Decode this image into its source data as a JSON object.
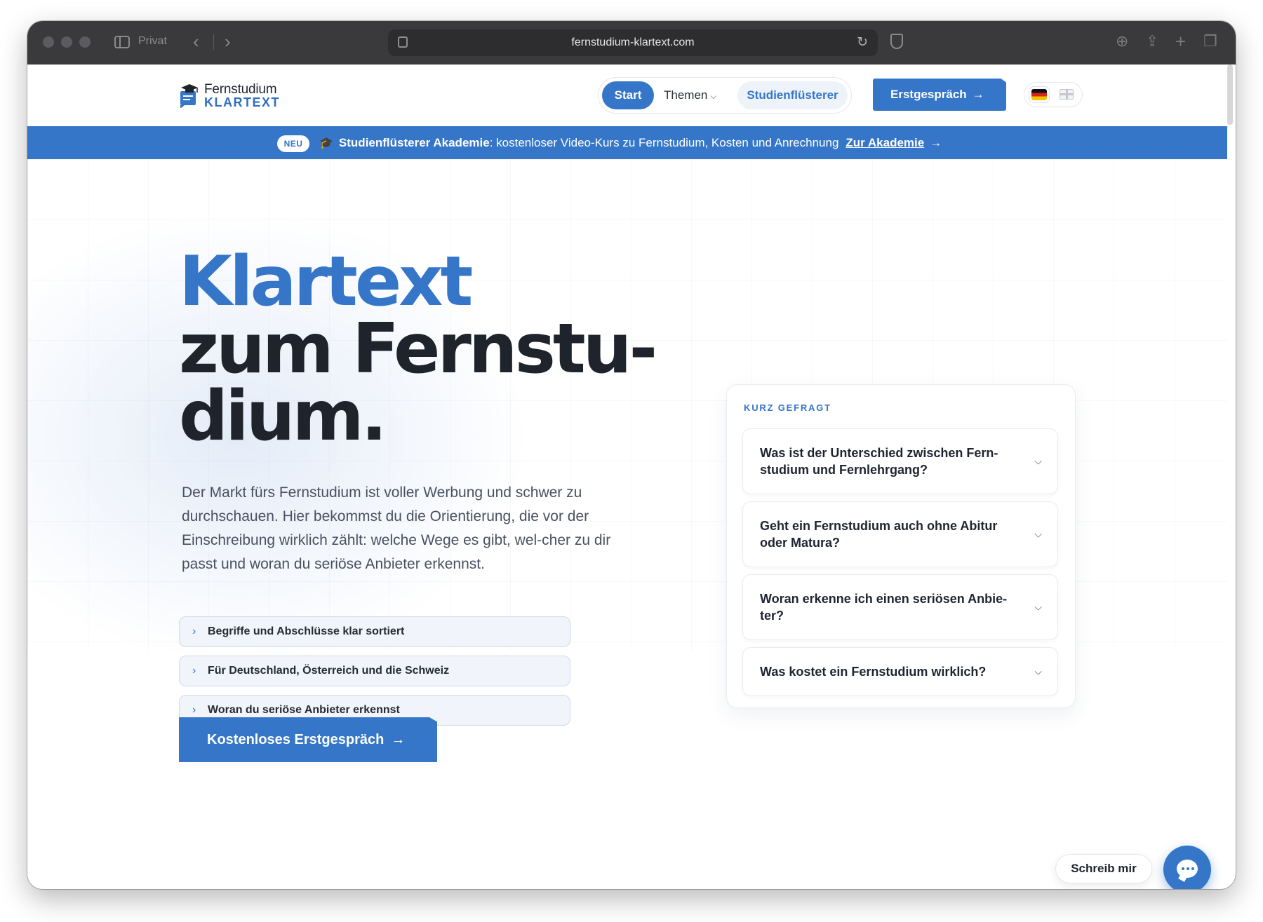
{
  "browser": {
    "private_label": "Privat",
    "url": "fernstudium-klartext.com"
  },
  "logo": {
    "line1": "Fernstudium",
    "line2": "KLARTEXT"
  },
  "nav": {
    "start": "Start",
    "themen": "Themen",
    "studienfluesterer": "Studienflüsterer",
    "cta": "Erstgespräch"
  },
  "banner": {
    "badge": "NEU",
    "title": "Studienflüsterer Akademie",
    "text": ": kostenloser Video-Kurs zu Fernstudium, Kosten und Anrechnung",
    "link": "Zur Akademie"
  },
  "hero": {
    "title_line1": "Klartext",
    "title_line2": "zum Fernstu-",
    "title_line3": "dium.",
    "text": "Der Markt fürs Fernstudium ist voller Werbung und schwer zu durchschauen. Hier bekommst du die Orientierung, die vor der Einschreibung wirklich zählt: welche Wege es gibt, wel-cher zu dir passt und woran du seriöse Anbieter erkennst.",
    "features": [
      "Begriffe und Abschlüsse klar sortiert",
      "Für Deutschland, Österreich und die Schweiz",
      "Woran du seriöse Anbieter erkennst"
    ],
    "cta": "Kostenloses Erstgespräch"
  },
  "faq": {
    "label": "KURZ GEFRAGT",
    "items": [
      "Was ist der Unterschied zwischen Fern-studium und Fernlehrgang?",
      "Geht ein Fernstudium auch ohne Abitur oder Matura?",
      "Woran erkenne ich einen seriösen Anbie-ter?",
      "Was kostet ein Fernstudium wirklich?"
    ]
  },
  "chat": {
    "label": "Schreib mir"
  },
  "colors": {
    "accent": "#3576c8",
    "text_dark": "#1e232c"
  }
}
